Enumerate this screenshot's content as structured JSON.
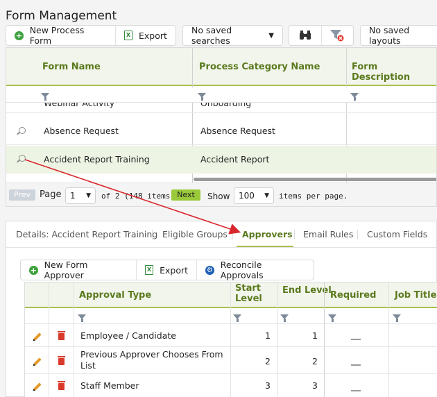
{
  "page": {
    "title": "Form Management"
  },
  "toolbar": {
    "new_label": "New Process Form",
    "export_label": "Export",
    "saved_searches": "No saved searches",
    "saved_layouts": "No saved layouts"
  },
  "grid": {
    "columns": [
      "Form Name",
      "Process Category Name",
      "Form Description"
    ],
    "partial_row": [
      "Webinar Activity",
      "Onboarding"
    ],
    "rows": [
      {
        "name": "Absence Request",
        "category": "Absence Request",
        "description": ""
      },
      {
        "name": "Accident Report Training",
        "category": "Accident Report",
        "description": ""
      }
    ],
    "pager": {
      "prev": "Prev",
      "page_label": "Page",
      "page_value": "1",
      "of_text": "of 2 (148 items)",
      "next": "Next",
      "show_label": "Show",
      "show_value": "100",
      "per_page": "items per page."
    }
  },
  "details": {
    "tabs": [
      "Details: Accident Report Training",
      "Eligible Groups",
      "Approvers",
      "Email Rules",
      "Custom Fields"
    ],
    "active_tab": "Approvers",
    "toolbar": {
      "new_label": "New Form Approver",
      "export_label": "Export",
      "reconcile_label": "Reconcile Approvals"
    },
    "columns": {
      "approval_type": "Approval Type",
      "start_level_1": "Start",
      "start_level_2": "Level",
      "end_level": "End Level",
      "required": "Required",
      "job_title": "Job Title"
    },
    "rows": [
      {
        "type": "Employee / Candidate",
        "start": "1",
        "end": "1"
      },
      {
        "type_line1": "Previous Approver Chooses From",
        "type_line2": "List",
        "start": "2",
        "end": "2"
      },
      {
        "type": "Staff Member",
        "start": "3",
        "end": "3"
      }
    ]
  },
  "colors": {
    "accent": "#a7c04a",
    "header_text": "#5b7a1e",
    "annotation_arrow": "#d9262c"
  }
}
